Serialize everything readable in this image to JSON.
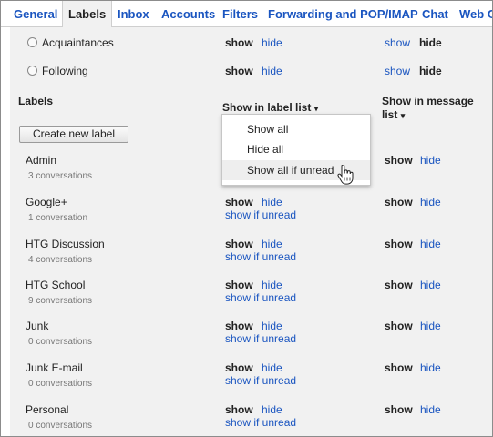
{
  "tabs": [
    {
      "label": "General",
      "active": false
    },
    {
      "label": "Labels",
      "active": true
    },
    {
      "label": "Inbox",
      "active": false
    },
    {
      "label": "Accounts",
      "active": false
    },
    {
      "label": "Filters",
      "active": false
    },
    {
      "label": "Forwarding and POP/IMAP",
      "active": false
    },
    {
      "label": "Chat",
      "active": false
    },
    {
      "label": "Web C",
      "active": false
    }
  ],
  "top_rows": [
    {
      "name": "Acquaintances",
      "list_show": "show",
      "list_hide": "hide",
      "msg_show": "show",
      "msg_hide": "hide"
    },
    {
      "name": "Following",
      "list_show": "show",
      "list_hide": "hide",
      "msg_show": "show",
      "msg_hide": "hide"
    }
  ],
  "labels_section": {
    "title": "Labels",
    "create_button": "Create new label",
    "col_label_list": "Show in label list",
    "col_message_list_line1": "Show in message",
    "col_message_list_line2": "list",
    "caret": "▾"
  },
  "dropdown": {
    "items": [
      "Show all",
      "Hide all",
      "Show all if unread"
    ],
    "hovered_index": 2
  },
  "labels": [
    {
      "name": "Admin",
      "count": "3 conversations",
      "list_show": "",
      "list_hide": "",
      "list_unread": "",
      "msg_show": "show",
      "msg_hide": "hide"
    },
    {
      "name": "Google+",
      "count": "1 conversation",
      "list_show": "show",
      "list_hide": "hide",
      "list_unread": "show if unread",
      "msg_show": "show",
      "msg_hide": "hide"
    },
    {
      "name": "HTG Discussion",
      "count": "4 conversations",
      "list_show": "show",
      "list_hide": "hide",
      "list_unread": "show if unread",
      "msg_show": "show",
      "msg_hide": "hide"
    },
    {
      "name": "HTG School",
      "count": "9 conversations",
      "list_show": "show",
      "list_hide": "hide",
      "list_unread": "show if unread",
      "msg_show": "show",
      "msg_hide": "hide"
    },
    {
      "name": "Junk",
      "count": "0 conversations",
      "list_show": "show",
      "list_hide": "hide",
      "list_unread": "show if unread",
      "msg_show": "show",
      "msg_hide": "hide"
    },
    {
      "name": "Junk E-mail",
      "count": "0 conversations",
      "list_show": "show",
      "list_hide": "hide",
      "list_unread": "show if unread",
      "msg_show": "show",
      "msg_hide": "hide"
    },
    {
      "name": "Personal",
      "count": "0 conversations",
      "list_show": "show",
      "list_hide": "hide",
      "list_unread": "show if unread",
      "msg_show": "show",
      "msg_hide": "hide"
    }
  ],
  "colors": {
    "link": "#1a55c0",
    "panel_bg": "#f1f1f1",
    "menu_hover": "#eeeeee"
  },
  "icons": {
    "radio": "radio-circle-icon",
    "cursor": "hand-pointer-icon"
  }
}
